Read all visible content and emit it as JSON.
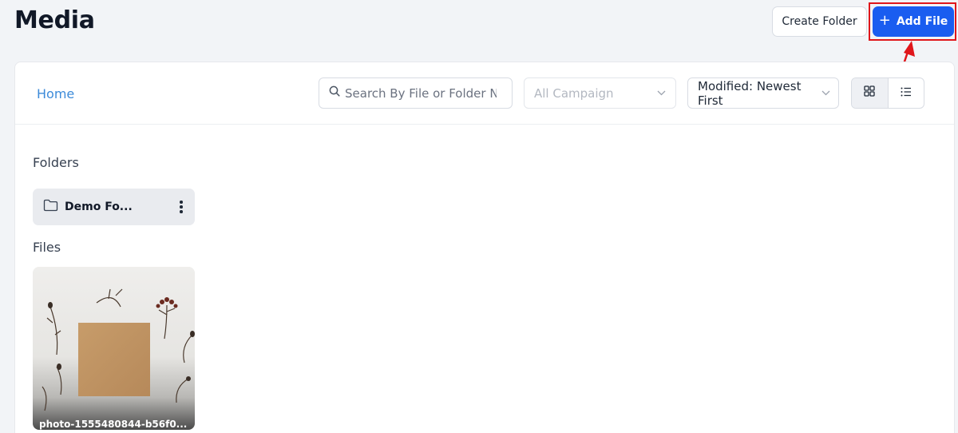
{
  "header": {
    "title": "Media",
    "create_folder_label": "Create Folder",
    "add_file_label": "Add File"
  },
  "toolbar": {
    "breadcrumb_home": "Home",
    "search_placeholder": "Search By File or Folder Name",
    "campaign_placeholder": "All Campaign",
    "sort_value": "Modified: Newest First",
    "view_mode": "grid"
  },
  "folders": {
    "label": "Folders",
    "items": [
      {
        "name": "Demo Fo..."
      }
    ]
  },
  "files": {
    "label": "Files",
    "items": [
      {
        "name": "photo-1555480844-b56f0..."
      }
    ]
  },
  "colors": {
    "accent": "#1a5df0",
    "link": "#3d8bd9",
    "annotation": "#e0161b"
  }
}
